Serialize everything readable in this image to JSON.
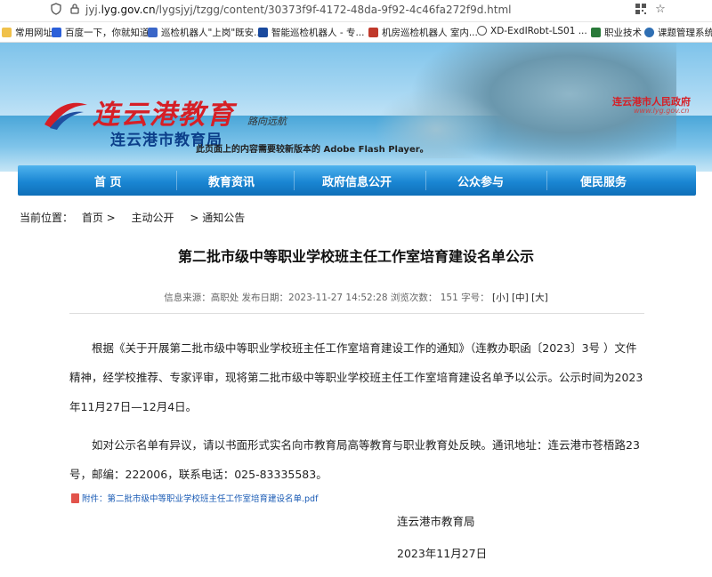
{
  "browser": {
    "url_prefix": "jyj.",
    "url_domain": "lyg.gov.cn",
    "url_path": "/lygsjyj/tzgg/content/30373f9f-4172-48da-9f92-4c46fa272f9d.html"
  },
  "bookmarks": [
    {
      "label": "常用网址",
      "color": "#666666"
    },
    {
      "label": "百度一下，你就知道",
      "color": "#2b5fd9"
    },
    {
      "label": "巡检机器人\"上岗\"既安...",
      "color": "#3a66c8"
    },
    {
      "label": "智能巡检机器人 - 专...",
      "color": "#1a4a9e"
    },
    {
      "label": "机房巡检机器人 室内...",
      "color": "#c0392b"
    },
    {
      "label": "XD-ExdIRobt-LS01 ...",
      "color": "#555555"
    },
    {
      "label": "职业技术",
      "color": "#2a7a3a"
    },
    {
      "label": "课题管理系统",
      "color": "#2f6fb3"
    }
  ],
  "banner": {
    "logo_title": "连云港教育",
    "logo_signature": "路向远航",
    "logo_subtitle": "连云港市教育局",
    "flash_notice": "此页面上的内容需要较新版本的 Adobe Flash Player。",
    "gov_link": "连云港市人民政府",
    "gov_url": "www.lyg.gov.cn"
  },
  "nav": [
    "首 页",
    "教育资讯",
    "政府信息公开",
    "公众参与",
    "便民服务"
  ],
  "breadcrumb": {
    "label": "当前位置：",
    "items": [
      "首页 >",
      "主动公开",
      "> 通知公告"
    ]
  },
  "article": {
    "title": "第二批市级中等职业学校班主任工作室培育建设名单公示",
    "meta_text": "信息来源：高职处 发布日期：2023-11-27 14:52:28 浏览次数：  151 字号：",
    "font_small": "[小]",
    "font_medium": "[中]",
    "font_large": "[大]",
    "paragraph1": "根据《关于开展第二批市级中等职业学校班主任工作室培育建设工作的通知》（连教办职函〔2023〕3号 ）文件精神，经学校推荐、专家评审，现将第二批市级中等职业学校班主任工作室培育建设名单予以公示。公示时间为2023年11月27日—12月4日。",
    "paragraph2": "如对公示名单有异议，请以书面形式实名向市教育局高等教育与职业教育处反映。通讯地址：连云港市苍梧路23号，邮编：222006，联系电话：025-83335583。",
    "attachment": "附件：第二批市级中等职业学校班主任工作室培育建设名单.pdf",
    "signature_org": "连云港市教育局",
    "signature_date": "2023年11月27日"
  },
  "colors": {
    "nav_blue": "#1a86d3",
    "logo_red": "#d61f26",
    "subtitle_blue": "#0c3f8a",
    "link_blue": "#1a5bb5"
  }
}
